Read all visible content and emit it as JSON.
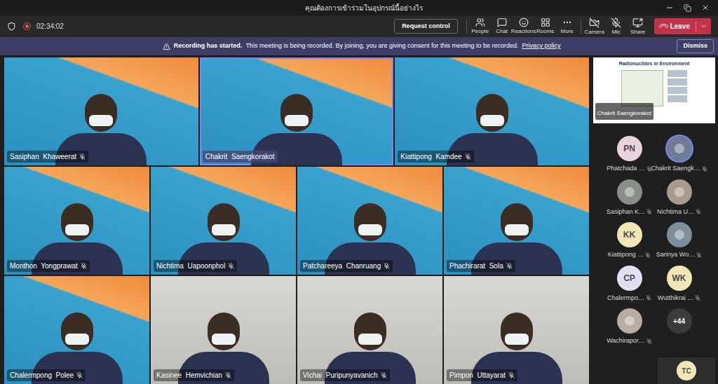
{
  "window": {
    "title": "คุณต้องการเข้าร่วมในอุปกรณ์นี้อย่างไร"
  },
  "toolbar": {
    "timer": "02:34:02",
    "recording": true,
    "request_control": "Request control",
    "tools": [
      {
        "label": "People"
      },
      {
        "label": "Chat"
      },
      {
        "label": "Reactions"
      },
      {
        "label": "Rooms"
      },
      {
        "label": "More"
      }
    ],
    "devices": [
      {
        "label": "Camera",
        "on": false
      },
      {
        "label": "Mic",
        "on": false
      },
      {
        "label": "Share",
        "on": true
      }
    ],
    "leave": "Leave"
  },
  "banner": {
    "title": "Recording has started.",
    "message": "This meeting is being recorded. By joining, you are giving consent for this meeting to be recorded.",
    "link": "Privacy policy",
    "dismiss": "Dismiss"
  },
  "video_rows": [
    [
      {
        "name": "Sasiphan  Khaweerat",
        "kind": "virtual",
        "muted": true,
        "speaking": false
      },
      {
        "name": "Chakrit  Saengkorakot",
        "kind": "virtual",
        "muted": false,
        "speaking": true
      },
      {
        "name": "Kiattipong  Kamdee",
        "kind": "virtual",
        "muted": true,
        "speaking": false
      }
    ],
    [
      {
        "name": "Monthon  Yongprawat",
        "kind": "virtual",
        "muted": true,
        "speaking": false
      },
      {
        "name": "Nichtima  Uapoonphol",
        "kind": "virtual",
        "muted": true,
        "speaking": false
      },
      {
        "name": "Patchareeya  Chanruang",
        "kind": "virtual",
        "muted": true,
        "speaking": false
      },
      {
        "name": "Phachirarat  Sola",
        "kind": "virtual",
        "muted": true,
        "speaking": false
      }
    ],
    [
      {
        "name": "Chalermpong  Polee",
        "kind": "virtual",
        "muted": true,
        "speaking": false
      },
      {
        "name": "Kasinee  Hemvichian",
        "kind": "room",
        "muted": true,
        "speaking": false
      },
      {
        "name": "Vichai  Puripunyavanich",
        "kind": "room",
        "muted": true,
        "speaking": false
      },
      {
        "name": "Pimpon  Uttayarat",
        "kind": "room",
        "muted": true,
        "speaking": false
      }
    ]
  ],
  "shared_content": {
    "title": "Radionuclides in Environment",
    "presenter": "Chakrit Saengkorakot"
  },
  "participants": [
    {
      "initials": "PN",
      "name": "Phatchada …",
      "kind": "initials",
      "color": "#e9d3dc",
      "muted": true,
      "speaking": false
    },
    {
      "initials": "",
      "name": "Chakrit Saengk…",
      "kind": "photo",
      "color": "#6f7c95",
      "muted": true,
      "speaking": true
    },
    {
      "initials": "",
      "name": "Sasiphan K…",
      "kind": "photo",
      "color": "#8a8f86",
      "muted": true,
      "speaking": false
    },
    {
      "initials": "",
      "name": "Nichtima U…",
      "kind": "photo",
      "color": "#a89a8e",
      "muted": true,
      "speaking": false
    },
    {
      "initials": "KK",
      "name": "Kiattipong …",
      "kind": "initials",
      "color": "#f3e6b6",
      "muted": true,
      "speaking": false
    },
    {
      "initials": "",
      "name": "Sarinya Wo…",
      "kind": "photo",
      "color": "#7d8f9c",
      "muted": true,
      "speaking": false
    },
    {
      "initials": "CP",
      "name": "Chalermpo…",
      "kind": "initials",
      "color": "#e3dff2",
      "muted": true,
      "speaking": false
    },
    {
      "initials": "WK",
      "name": "Wutthikrai …",
      "kind": "initials",
      "color": "#f3e6b6",
      "muted": true,
      "speaking": false
    },
    {
      "initials": "",
      "name": "Wachirapor…",
      "kind": "photo",
      "color": "#b9aca3",
      "muted": true,
      "speaking": false
    }
  ],
  "overflow": "+44",
  "self_view": {
    "initials": "TC"
  }
}
